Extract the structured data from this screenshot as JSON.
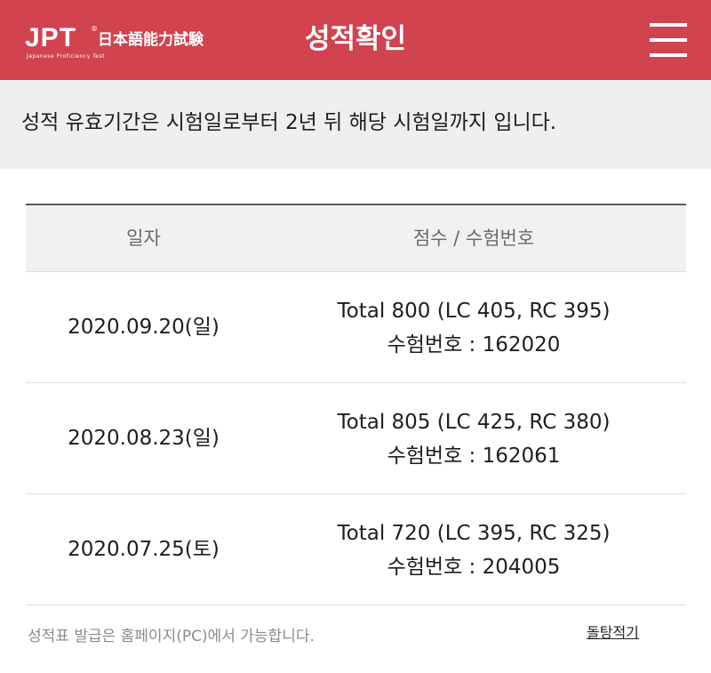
{
  "header": {
    "logo": {
      "brand": "JPT",
      "registered_mark": "®",
      "kanji": "日本語能力試験",
      "subtitle": "Japanese Proficiency Test"
    },
    "title": "성적확인",
    "menu_icon": "hamburger-menu-icon"
  },
  "notice": {
    "text": "성적 유효기간은 시험일로부터 2년 뒤 해당 시험일까지 입니다."
  },
  "table": {
    "columns": [
      "일자",
      "점수 / 수험번호"
    ],
    "rows": [
      {
        "date": "2020.09.20(일)",
        "score": "Total 800 (LC 405, RC 395)",
        "exam_number": "수험번호 : 162020"
      },
      {
        "date": "2020.08.23(일)",
        "score": "Total 805 (LC 425, RC 380)",
        "exam_number": "수험번호 : 162061"
      },
      {
        "date": "2020.07.25(토)",
        "score": "Total 720 (LC 395, RC 325)",
        "exam_number": "수험번호 : 204005"
      }
    ]
  },
  "footer": {
    "note": "성적표 발급은 홈페이지(PC)에서 가능합니다.",
    "link": "돌탕적기"
  },
  "colors": {
    "brand_red": "#d0434f",
    "notice_bg": "#efefef",
    "table_header_bg": "#f1f1f1"
  }
}
